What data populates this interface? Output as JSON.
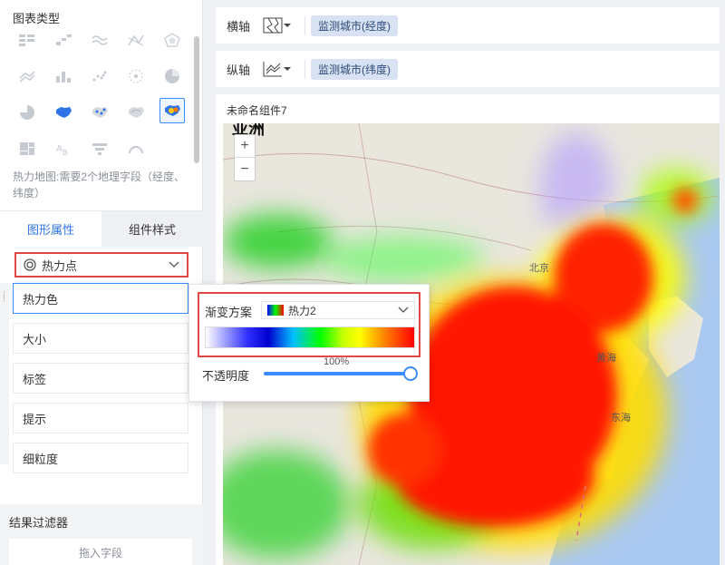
{
  "left": {
    "chart_type_title": "图表类型",
    "chart_types": [
      "table-icon",
      "bar-icon",
      "line-icon",
      "chart-icon",
      "radar-icon",
      "area-icon",
      "column-icon",
      "scatter-icon",
      "bubble-icon",
      "pie-icon",
      "rose-icon",
      "china-map-icon",
      "dot-map-icon",
      "flow-map-icon",
      "heatmap-icon",
      "treemap-icon",
      "wordcloud-icon",
      "funnel-icon",
      "gauge-icon"
    ],
    "selected_chart": "heatmap-icon",
    "hint": "热力地图:需要2个地理字段（经度、纬度）",
    "tabs": {
      "graph_props": "图形属性",
      "widget_style": "组件样式"
    },
    "point_type": "热力点",
    "props": [
      "热力色",
      "大小",
      "标签",
      "提示",
      "细粒度"
    ],
    "filter_title": "结果过滤器",
    "dropzone": "拖入字段"
  },
  "axes": {
    "x_label": "横轴",
    "x_field": "监测城市(经度)",
    "y_label": "纵轴",
    "y_field": "监测城市(纬度)"
  },
  "widget": {
    "title": "未命名组件7",
    "zoom_in": "+",
    "zoom_out": "−",
    "map_labels": {
      "asia": "亚洲",
      "beijing": "北京",
      "yellow_sea": "黄海",
      "east_sea": "东海"
    }
  },
  "popup": {
    "scheme_label": "渐变方案",
    "scheme_value": "热力2",
    "opacity_label": "不透明度",
    "opacity_value": "100%",
    "opacity": 1.0
  },
  "colors": {
    "accent": "#3d8bff",
    "highlight": "#e04848"
  }
}
